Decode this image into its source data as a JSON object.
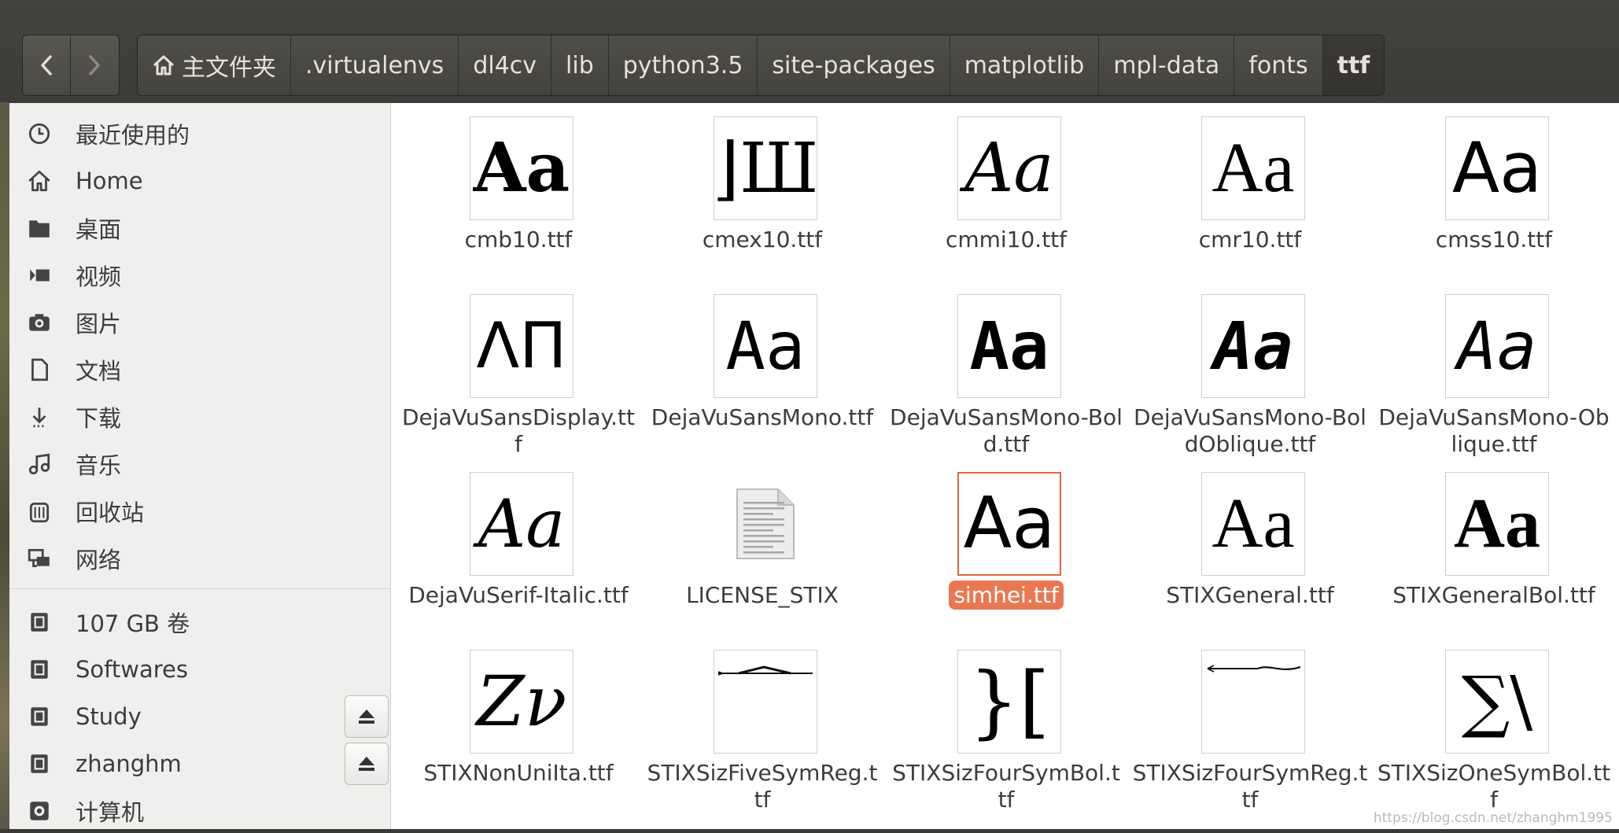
{
  "navigation": {
    "back_icon": "chevron-left-icon",
    "forward_icon": "chevron-right-icon"
  },
  "breadcrumbs": [
    {
      "label": "主文件夹",
      "icon": "home-icon"
    },
    {
      "label": ".virtualenvs"
    },
    {
      "label": "dl4cv"
    },
    {
      "label": "lib"
    },
    {
      "label": "python3.5"
    },
    {
      "label": "site-packages"
    },
    {
      "label": "matplotlib"
    },
    {
      "label": "mpl-data"
    },
    {
      "label": "fonts"
    },
    {
      "label": "ttf"
    }
  ],
  "sidebar": {
    "places": [
      {
        "label": "最近使用的",
        "icon": "clock-icon"
      },
      {
        "label": "Home",
        "icon": "home-icon"
      },
      {
        "label": "桌面",
        "icon": "folder-icon"
      },
      {
        "label": "视频",
        "icon": "video-icon"
      },
      {
        "label": "图片",
        "icon": "camera-icon"
      },
      {
        "label": "文档",
        "icon": "document-icon"
      },
      {
        "label": "下载",
        "icon": "download-icon"
      },
      {
        "label": "音乐",
        "icon": "music-icon"
      },
      {
        "label": "回收站",
        "icon": "trash-icon"
      },
      {
        "label": "网络",
        "icon": "network-icon"
      }
    ],
    "devices": [
      {
        "label": "107 GB 卷",
        "icon": "drive-icon"
      },
      {
        "label": "Softwares",
        "icon": "drive-icon"
      },
      {
        "label": "Study",
        "icon": "drive-icon",
        "eject": true
      },
      {
        "label": "zhanghm",
        "icon": "drive-icon",
        "eject": true
      },
      {
        "label": "计算机",
        "icon": "computer-icon"
      }
    ]
  },
  "files": [
    {
      "name": "cmb10.ttf",
      "preview": "Aa",
      "style": "cmb"
    },
    {
      "name": "cmex10.ttf",
      "preview": "⌋Ш",
      "style": "cmex"
    },
    {
      "name": "cmmi10.ttf",
      "preview": "Aa",
      "style": "cmmi"
    },
    {
      "name": "cmr10.ttf",
      "preview": "Aa",
      "style": "cmr"
    },
    {
      "name": "cmss10.ttf",
      "preview": "Aa",
      "style": "cmss"
    },
    {
      "name": "DejaVuSansDisplay.ttf",
      "preview": "ΛΠ",
      "style": "djdisp"
    },
    {
      "name": "DejaVuSansMono.ttf",
      "preview": "Aa",
      "style": "mono"
    },
    {
      "name": "DejaVuSansMono-Bold.ttf",
      "preview": "Aa",
      "style": "monob"
    },
    {
      "name": "DejaVuSansMono-BoldOblique.ttf",
      "preview": "Aa",
      "style": "monobo"
    },
    {
      "name": "DejaVuSansMono-Oblique.ttf",
      "preview": "Aa",
      "style": "monoo"
    },
    {
      "name": "DejaVuSerif-Italic.ttf",
      "preview": "Aa",
      "style": "serifi"
    },
    {
      "name": "LICENSE_STIX",
      "preview": "",
      "style": "doc"
    },
    {
      "name": "simhei.ttf",
      "preview": "Aa",
      "style": "simhei",
      "selected": true
    },
    {
      "name": "STIXGeneral.ttf",
      "preview": "Aa",
      "style": "stixg"
    },
    {
      "name": "STIXGeneralBol.ttf",
      "preview": "Aa",
      "style": "stixgb"
    },
    {
      "name": "STIXNonUniIta.ttf",
      "preview": "Zν",
      "style": "stixnui"
    },
    {
      "name": "STIXSizFiveSymReg.ttf",
      "preview": "",
      "style": "five"
    },
    {
      "name": "STIXSizFourSymBol.ttf",
      "preview": "}[",
      "style": "fourb"
    },
    {
      "name": "STIXSizFourSymReg.ttf",
      "preview": "",
      "style": "fourr"
    },
    {
      "name": "STIXSizOneSymBol.ttf",
      "preview": "∑\\",
      "style": "oneb"
    }
  ],
  "watermark": "https://blog.csdn.net/zhanghm1995"
}
